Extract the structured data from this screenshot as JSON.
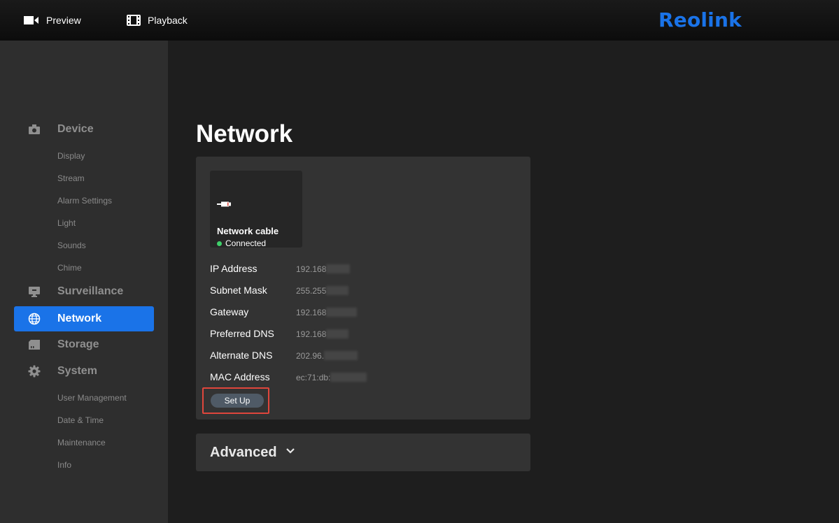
{
  "topbar": {
    "preview_label": "Preview",
    "playback_label": "Playback",
    "brand": "Reolink",
    "brand_color": "#1a73e8"
  },
  "sidebar": {
    "sections": [
      {
        "label": "Device",
        "icon": "camera-icon",
        "active": false,
        "items": [
          "Display",
          "Stream",
          "Alarm Settings",
          "Light",
          "Sounds",
          "Chime"
        ]
      },
      {
        "label": "Surveillance",
        "icon": "monitor-icon",
        "active": false,
        "items": []
      },
      {
        "label": "Network",
        "icon": "globe-icon",
        "active": true,
        "items": []
      },
      {
        "label": "Storage",
        "icon": "sd-card-icon",
        "active": false,
        "items": []
      },
      {
        "label": "System",
        "icon": "gear-icon",
        "active": false,
        "items": [
          "User Management",
          "Date & Time",
          "Maintenance",
          "Info"
        ]
      }
    ],
    "active_color": "#1a73e8"
  },
  "main": {
    "title": "Network",
    "connection": {
      "icon": "ethernet-plug-icon",
      "type": "Network cable",
      "status": "Connected",
      "status_color": "#3fcf6a"
    },
    "info": [
      {
        "label": "IP Address",
        "value": "192.168"
      },
      {
        "label": "Subnet Mask",
        "value": "255.255"
      },
      {
        "label": "Gateway",
        "value": "192.168"
      },
      {
        "label": "Preferred DNS",
        "value": "192.168"
      },
      {
        "label": "Alternate DNS",
        "value": "202.96."
      },
      {
        "label": "MAC Address",
        "value": "ec:71:db:"
      }
    ],
    "setup_label": "Set Up",
    "advanced_label": "Advanced"
  }
}
